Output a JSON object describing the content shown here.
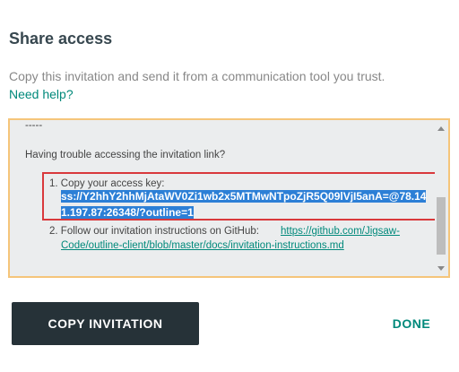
{
  "dialog": {
    "title": "Share access",
    "description": "Copy this invitation and send it from a communication tool you trust.",
    "help_link": "Need help?"
  },
  "invitation": {
    "dashes": "-----",
    "trouble_text": "Having trouble accessing the invitation link?",
    "step1_num": "1.",
    "step1_label": "Copy your access key:",
    "access_key": "ss://Y2hhY2hhMjAtaWV0Zi1wb2x5MTMwNTpoZjR5Q09lVjI5anA=@78.141.197.87:26348/?outline=1",
    "step2_num": "2.",
    "step2_text": "Follow our invitation instructions on GitHub:",
    "github_link": "https://github.com/Jigsaw-Code/outline-client/blob/master/docs/invitation-instructions.md"
  },
  "buttons": {
    "copy_label": "COPY INVITATION",
    "done_label": "DONE"
  },
  "colors": {
    "accent": "#00897b",
    "box_border": "#f5c57a",
    "highlight_frame": "#d9393c",
    "selection": "#2c7fd6",
    "primary_button": "#263238"
  }
}
